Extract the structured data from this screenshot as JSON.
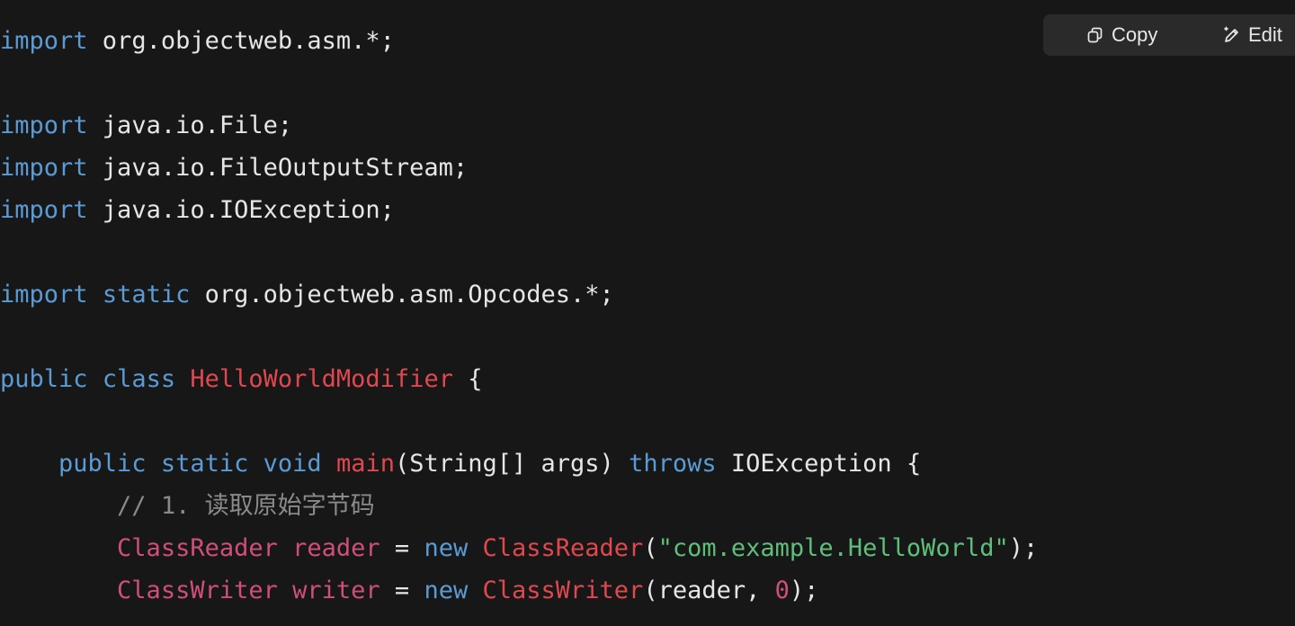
{
  "toolbar": {
    "copy_label": "Copy",
    "copy_icon": "copy-icon",
    "edit_label": "Edit",
    "edit_icon": "pencil-icon"
  },
  "code": {
    "language": "java",
    "colors": {
      "background": "#171717",
      "keyword": "#5b9bd5",
      "function": "#e0484f",
      "type": "#d04f7a",
      "string": "#5fbf7a",
      "comment": "#8a8a8a",
      "text": "#e6e6e6"
    },
    "lines": [
      [
        {
          "t": "import",
          "k": "kw"
        },
        {
          "t": " org.objectweb.asm.*;",
          "k": "plain"
        }
      ],
      [],
      [
        {
          "t": "import",
          "k": "kw"
        },
        {
          "t": " java.io.File;",
          "k": "plain"
        }
      ],
      [
        {
          "t": "import",
          "k": "kw"
        },
        {
          "t": " java.io.FileOutputStream;",
          "k": "plain"
        }
      ],
      [
        {
          "t": "import",
          "k": "kw"
        },
        {
          "t": " java.io.IOException;",
          "k": "plain"
        }
      ],
      [],
      [
        {
          "t": "import",
          "k": "kw"
        },
        {
          "t": " ",
          "k": "plain"
        },
        {
          "t": "static",
          "k": "kw"
        },
        {
          "t": " org.objectweb.asm.Opcodes.*;",
          "k": "plain"
        }
      ],
      [],
      [
        {
          "t": "public",
          "k": "kw"
        },
        {
          "t": " ",
          "k": "plain"
        },
        {
          "t": "class",
          "k": "kw"
        },
        {
          "t": " ",
          "k": "plain"
        },
        {
          "t": "HelloWorldModifier",
          "k": "fn"
        },
        {
          "t": " {",
          "k": "plain"
        }
      ],
      [],
      [
        {
          "t": "    ",
          "k": "plain"
        },
        {
          "t": "public",
          "k": "kw"
        },
        {
          "t": " ",
          "k": "plain"
        },
        {
          "t": "static",
          "k": "kw"
        },
        {
          "t": " ",
          "k": "plain"
        },
        {
          "t": "void",
          "k": "kw"
        },
        {
          "t": " ",
          "k": "plain"
        },
        {
          "t": "main",
          "k": "fn"
        },
        {
          "t": "(String[] args) ",
          "k": "plain"
        },
        {
          "t": "throws",
          "k": "kw"
        },
        {
          "t": " IOException {",
          "k": "plain"
        }
      ],
      [
        {
          "t": "        ",
          "k": "plain"
        },
        {
          "t": "// 1. 读取原始字节码",
          "k": "cmt"
        }
      ],
      [
        {
          "t": "        ",
          "k": "plain"
        },
        {
          "t": "ClassReader",
          "k": "type"
        },
        {
          "t": " ",
          "k": "plain"
        },
        {
          "t": "reader",
          "k": "type"
        },
        {
          "t": " = ",
          "k": "plain"
        },
        {
          "t": "new",
          "k": "kw"
        },
        {
          "t": " ",
          "k": "plain"
        },
        {
          "t": "ClassReader",
          "k": "fn"
        },
        {
          "t": "(",
          "k": "plain"
        },
        {
          "t": "\"com.example.HelloWorld\"",
          "k": "str"
        },
        {
          "t": ");",
          "k": "plain"
        }
      ],
      [
        {
          "t": "        ",
          "k": "plain"
        },
        {
          "t": "ClassWriter",
          "k": "type"
        },
        {
          "t": " ",
          "k": "plain"
        },
        {
          "t": "writer",
          "k": "type"
        },
        {
          "t": " = ",
          "k": "plain"
        },
        {
          "t": "new",
          "k": "kw"
        },
        {
          "t": " ",
          "k": "plain"
        },
        {
          "t": "ClassWriter",
          "k": "fn"
        },
        {
          "t": "(reader, ",
          "k": "plain"
        },
        {
          "t": "0",
          "k": "num"
        },
        {
          "t": ");",
          "k": "plain"
        }
      ]
    ]
  }
}
